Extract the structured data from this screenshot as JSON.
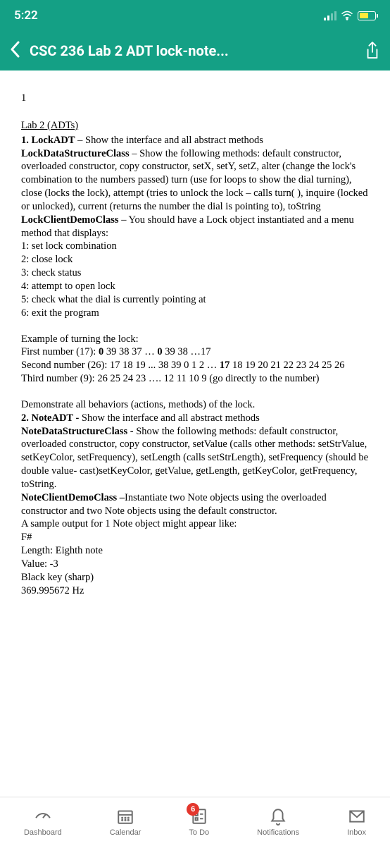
{
  "status": {
    "time": "5:22"
  },
  "nav": {
    "title": "CSC 236 Lab 2 ADT lock-note..."
  },
  "doc": {
    "page_num": "1",
    "lab_title": "Lab 2 (ADTs)",
    "lock_adt_label": "1. LockADT",
    "lock_adt_text": " – Show the interface and all abstract methods",
    "lock_ds_label": "LockDataStructureClass",
    "lock_ds_text": " – Show the following methods: default constructor, overloaded constructor, copy constructor, setX, setY, setZ, alter (change the lock's combination to the numbers passed) turn (use for loops to show the dial turning), close (locks the lock), attempt (tries to unlock the lock – calls turn( ), inquire (locked or unlocked), current (returns the number the dial is pointing to), toString",
    "lock_client_label": "LockClientDemoClass",
    "lock_client_text": " – You should have a Lock object instantiated and a menu method that displays:",
    "menu1": "1: set lock combination",
    "menu2": "2: close lock",
    "menu3": "3: check status",
    "menu4": "4: attempt to open lock",
    "menu5": "5: check what the dial is currently pointing at",
    "menu6": "6: exit the program",
    "example_heading": "Example of turning the lock:",
    "first_num_label": "First number (17):  ",
    "first_a": "0",
    "first_b": " 39 38 37 … ",
    "first_c": "0",
    "first_d": " 39 38 …17",
    "second_num_label": "Second number (26): 17 18 19 ... 38 39 0 1 2 … ",
    "second_bold": "17",
    "second_rest": " 18 19 20 21 22 23 24 25 26",
    "third_num": "Third number (9): 26 25 24 23 …. 12 11 10 9 (go directly to the number)",
    "demonstrate": "Demonstrate all behaviors (actions, methods) of the lock.",
    "note_adt_label": "2. NoteADT - ",
    "note_adt_text": "Show the interface and all abstract methods",
    "note_ds_label": "NoteDataStructureClass - ",
    "note_ds_text": "Show the following methods: default constructor, overloaded constructor, copy constructor, setValue (calls other methods: setStrValue, setKeyColor, setFrequency), setLength (calls setStrLength), setFrequency (should be double value- cast)setKeyColor, getValue, getLength, getKeyColor, getFrequency, toString.",
    "note_client_label": "NoteClientDemoClass –",
    "note_client_text": "Instantiate two Note objects using the overloaded constructor and two Note objects using the default constructor.",
    "sample_output": "A sample output for 1 Note object might appear like:",
    "s1": "F#",
    "s2": "Length: Eighth note",
    "s3": "Value: -3",
    "s4": "Black key (sharp)",
    "s5": "369.995672 Hz"
  },
  "bottom_nav": {
    "dashboard": "Dashboard",
    "calendar": "Calendar",
    "todo": "To Do",
    "notifications": "Notifications",
    "inbox": "Inbox",
    "todo_badge": "6"
  }
}
